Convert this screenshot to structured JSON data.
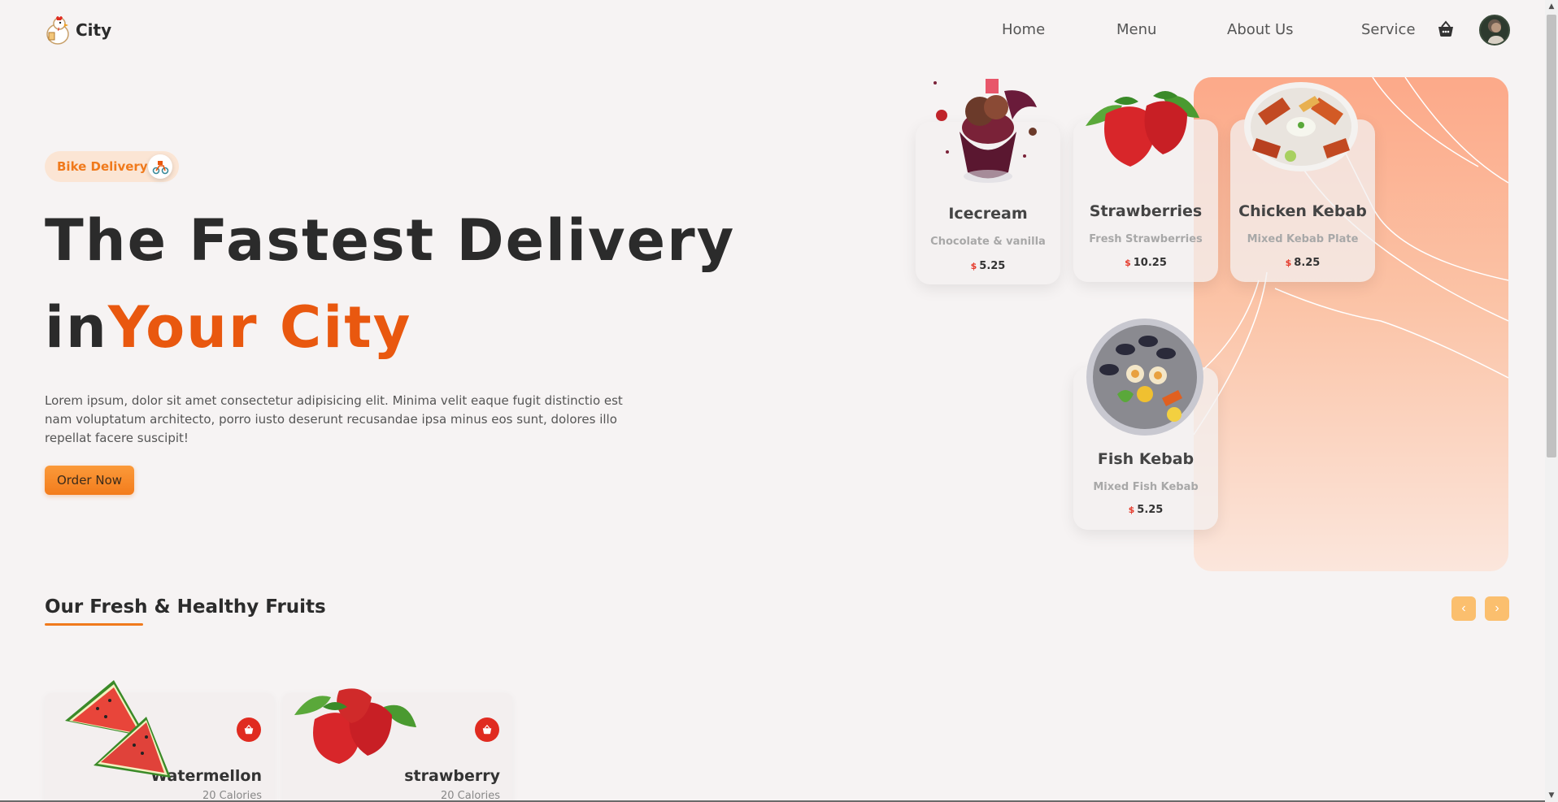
{
  "header": {
    "logo_text": "City",
    "nav": [
      "Home",
      "Menu",
      "About Us",
      "Service"
    ],
    "icons": [
      "chicken-logo-icon",
      "basket-icon",
      "avatar"
    ]
  },
  "hero": {
    "badge_label": "Bike Delivery",
    "title_line1": "The Fastest Delivery",
    "title_in": "in",
    "title_city": "Your City",
    "description": "Lorem ipsum, dolor sit amet consectetur adipisicing elit. Minima velit eaque fugit distinctio est nam voluptatum architecto, porro iusto deserunt recusandae ipsa minus eos sunt, dolores illo repellat facere suscipit!",
    "order_button": "Order Now"
  },
  "menu_cards": [
    {
      "name": "Icecream",
      "desc": "Chocolate & vanilla",
      "currency": "$",
      "price": "5.25"
    },
    {
      "name": "Strawberries",
      "desc": "Fresh Strawberries",
      "currency": "$",
      "price": "10.25"
    },
    {
      "name": "Chicken Kebab",
      "desc": "Mixed Kebab Plate",
      "currency": "$",
      "price": "8.25"
    },
    {
      "name": "Fish Kebab",
      "desc": "Mixed Fish Kebab",
      "currency": "$",
      "price": "5.25"
    }
  ],
  "fruits_section": {
    "title": "Our Fresh & Healthy Fruits",
    "prev_icon": "‹",
    "next_icon": "›",
    "items": [
      {
        "name": "Watermellon",
        "calories": "20 Calories"
      },
      {
        "name": "strawberry",
        "calories": "20 Calories"
      }
    ]
  },
  "colors": {
    "accent": "#e9580f",
    "accent_light": "#f07a1c",
    "panel_top": "#fca989",
    "cart_red": "#e02b20"
  }
}
